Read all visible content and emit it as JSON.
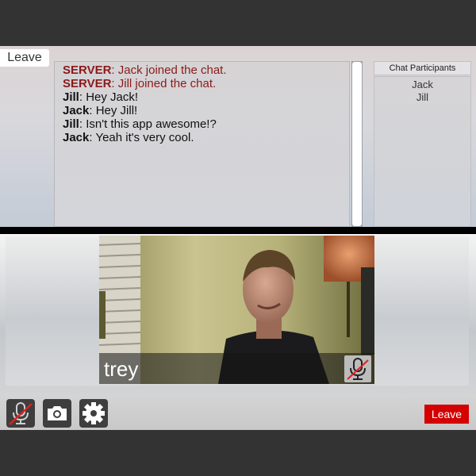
{
  "top_bar": {
    "leave_label": "Leave"
  },
  "chat": {
    "messages": [
      {
        "sender": "SERVER",
        "text": ": Jack joined the chat.",
        "type": "server"
      },
      {
        "sender": "SERVER",
        "text": ": Jill joined the chat.",
        "type": "server"
      },
      {
        "sender": "Jill",
        "text": ": Hey Jack!",
        "type": "user"
      },
      {
        "sender": "Jack",
        "text": ": Hey Jill!",
        "type": "user"
      },
      {
        "sender": "Jill",
        "text": ": Isn't this app awesome!?",
        "type": "user"
      },
      {
        "sender": "Jack",
        "text": ": Yeah it's very cool.",
        "type": "user"
      }
    ]
  },
  "participants": {
    "header": "Chat Participants",
    "names": [
      "Jack",
      "Jill"
    ]
  },
  "video": {
    "user_name": "trey",
    "mic_icon": "mic-muted-icon"
  },
  "toolbar": {
    "mic_icon": "mic-muted-icon",
    "camera_icon": "camera-icon",
    "settings_icon": "gear-icon",
    "leave_label": "Leave"
  },
  "colors": {
    "server_text": "#8b1a1a",
    "leave_button": "#d40000",
    "mute_slash": "#e02020"
  }
}
